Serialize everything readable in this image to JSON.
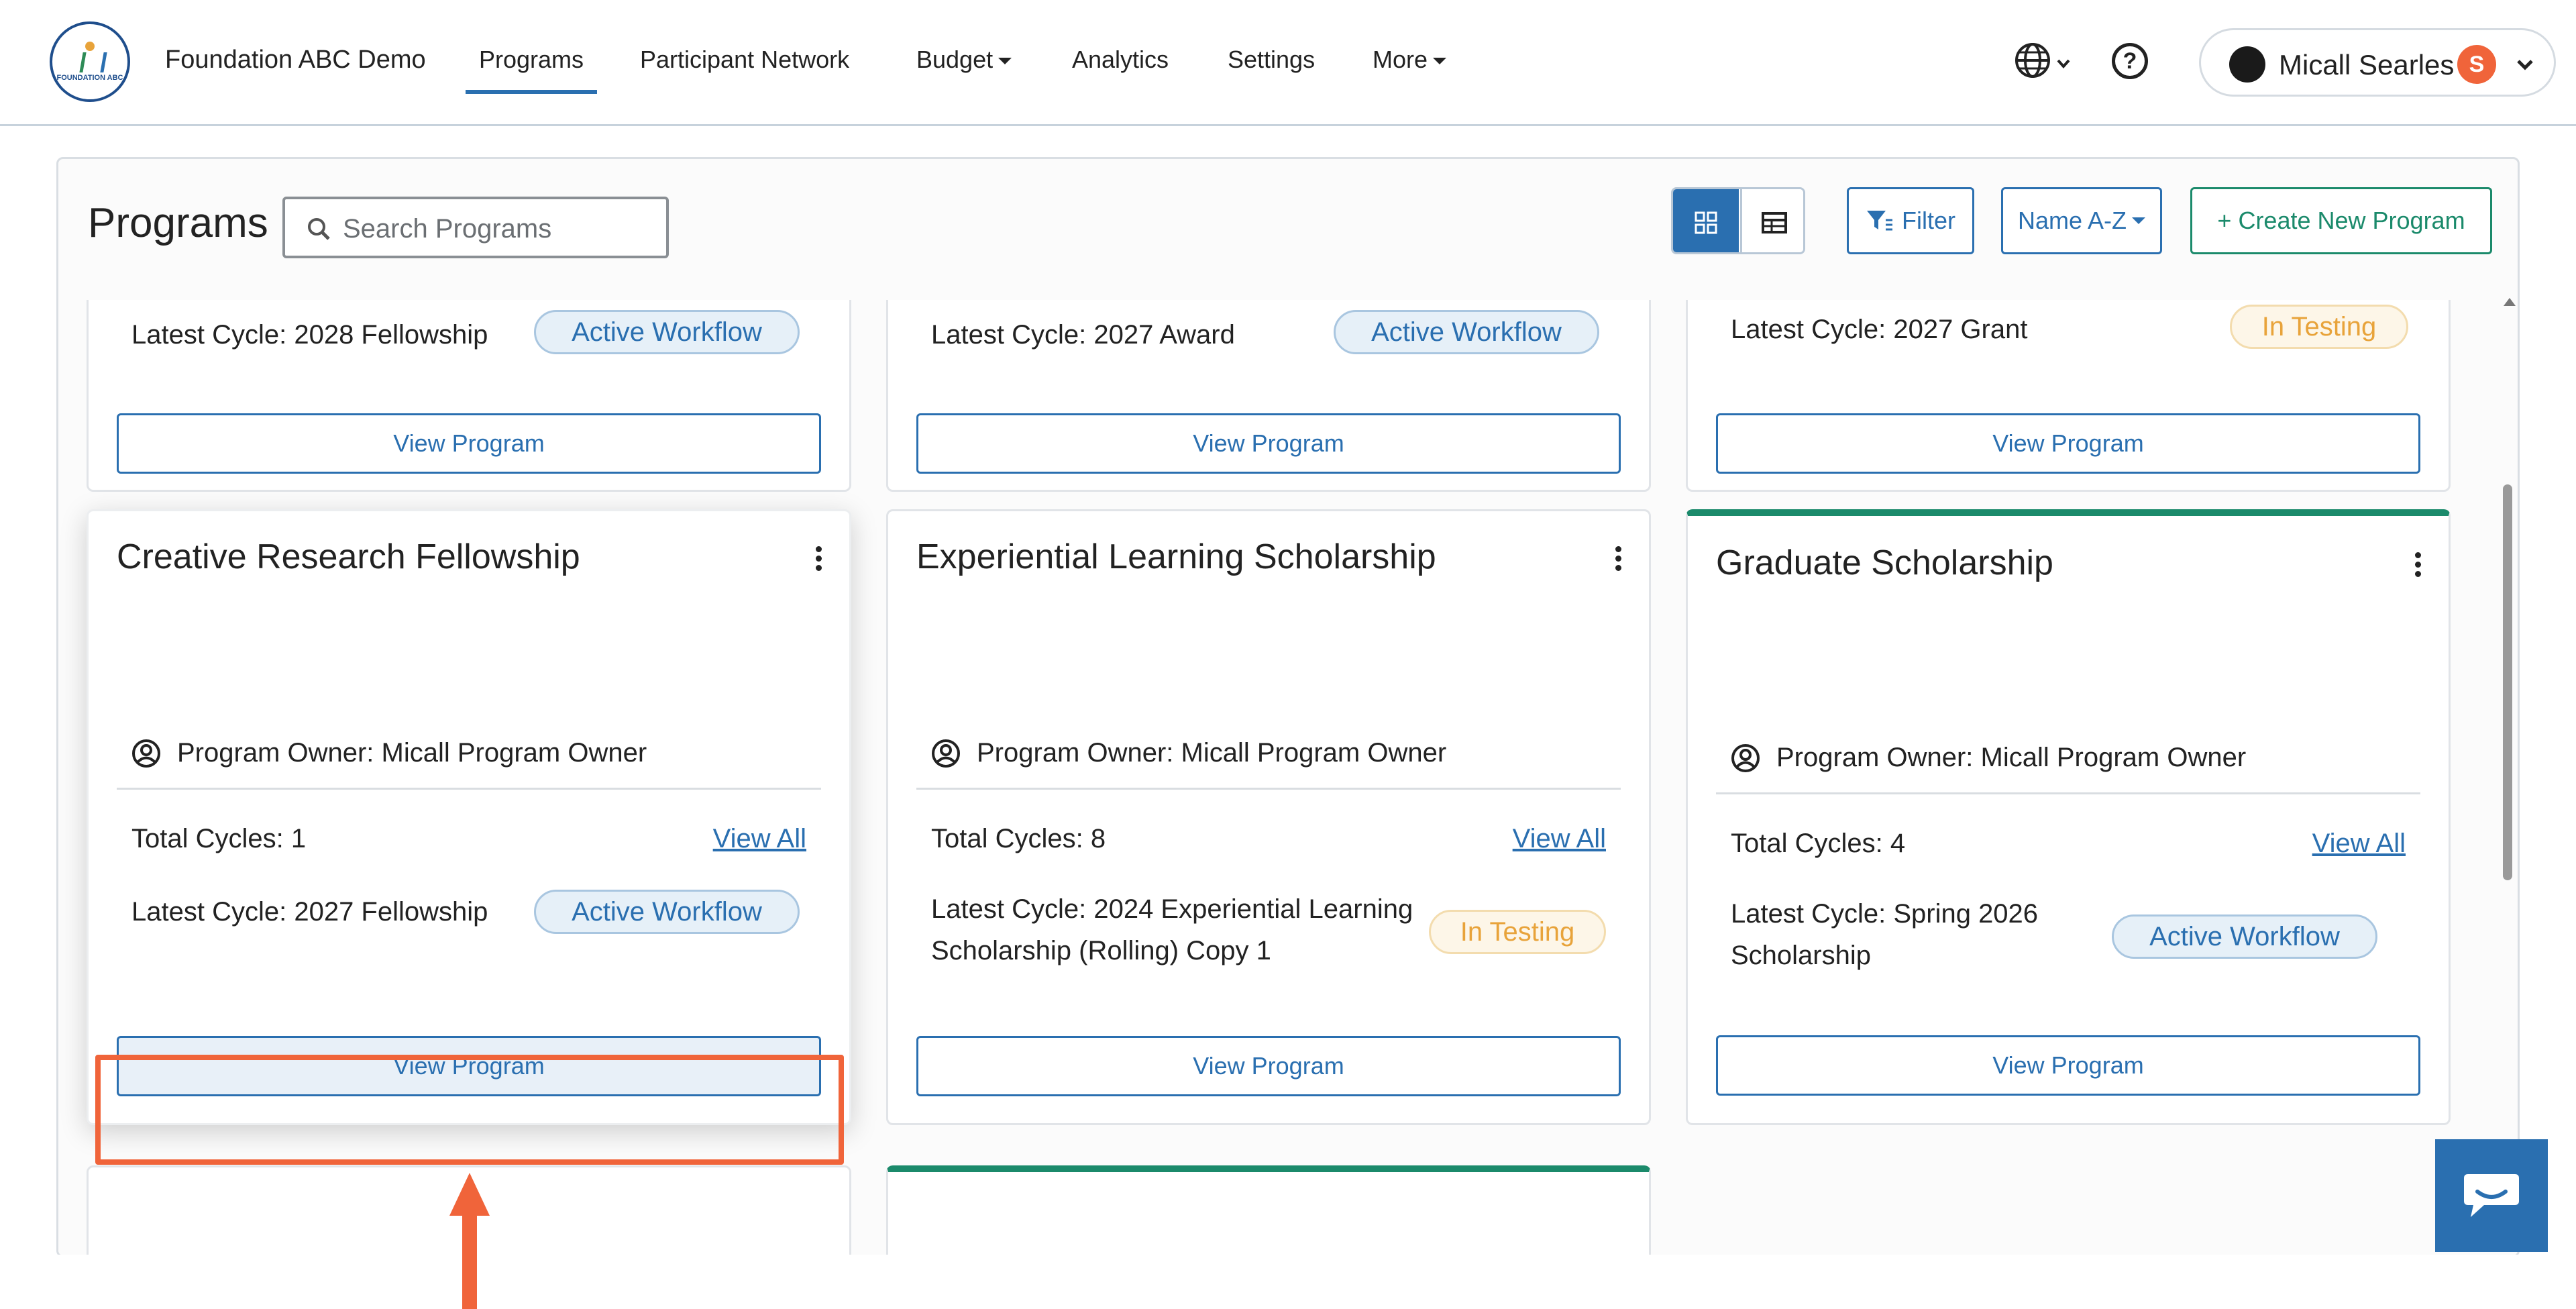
{
  "app": {
    "org_name": "Foundation ABC Demo",
    "logo_text": "FOUNDATION ABC"
  },
  "nav": {
    "items": [
      {
        "label": "Programs",
        "active": true
      },
      {
        "label": "Participant Network"
      },
      {
        "label": "Budget",
        "dropdown": true
      },
      {
        "label": "Analytics"
      },
      {
        "label": "Settings"
      },
      {
        "label": "More",
        "dropdown": true
      }
    ],
    "help_label": "?",
    "user": {
      "name": "Micall Searles",
      "badge": "S"
    }
  },
  "toolbar": {
    "page_title": "Programs",
    "search_placeholder": "Search Programs",
    "filter_label": "Filter",
    "sort_label": "Name A-Z",
    "create_label": "+ Create New Program"
  },
  "top_row": [
    {
      "latest": "Latest Cycle: 2028 Fellowship",
      "status": "Active Workflow",
      "status_type": "active",
      "button": "View Program"
    },
    {
      "latest": "Latest Cycle: 2027 Award",
      "status": "Active Workflow",
      "status_type": "active",
      "button": "View Program"
    },
    {
      "latest": "Latest Cycle: 2027 Grant",
      "status": "In Testing",
      "status_type": "testing",
      "button": "View Program"
    }
  ],
  "programs": [
    {
      "title": "Creative Research Fellowship",
      "owner": "Program Owner: Micall Program Owner",
      "total_cycles": "Total Cycles: 1",
      "view_all": "View All",
      "latest": "Latest Cycle: 2027 Fellowship",
      "status": "Active Workflow",
      "button": "View Program"
    },
    {
      "title": "Experiential Learning Scholarship",
      "owner": "Program Owner: Micall Program Owner",
      "total_cycles": "Total Cycles: 8",
      "view_all": "View All",
      "latest": "Latest Cycle: 2024 Experiential Learning Scholarship (Rolling) Copy 1",
      "status": "In Testing",
      "button": "View Program"
    },
    {
      "title": "Graduate Scholarship",
      "owner": "Program Owner: Micall Program Owner",
      "total_cycles": "Total Cycles: 4",
      "view_all": "View All",
      "latest": "Latest Cycle: Spring 2026 Scholarship",
      "status": "Active Workflow",
      "button": "View Program"
    }
  ],
  "colors": {
    "primary": "#2a6fb0",
    "accent_green": "#1b8a6b",
    "annotation": "#f0643a",
    "testing": "#e8a33a"
  }
}
